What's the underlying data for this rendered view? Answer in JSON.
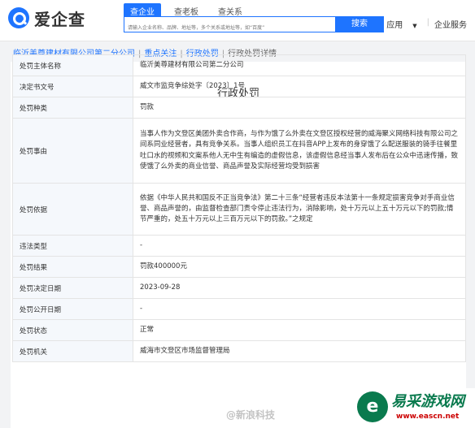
{
  "header": {
    "logo_text": "爱企查",
    "tabs": [
      "查企业",
      "查老板",
      "查关系"
    ],
    "search_placeholder": "请输入企业名称、品牌、地址等，多个关系或地址等，如“百度”",
    "search_button": "搜索",
    "nav": {
      "app": "应用",
      "service": "企业服务"
    }
  },
  "breadcrumb": {
    "company": "临沂美尊建材有限公司第二分公司",
    "follow": "重点关注",
    "penalty": "行政处罚",
    "current": "行政处罚详情"
  },
  "panel": {
    "title": "行政处罚",
    "rows": [
      {
        "label": "处罚主体名称",
        "value": "临沂美尊建材有限公司第二分公司"
      },
      {
        "label": "决定书文号",
        "value": "威文市监竞争综处字〔2023〕1号"
      },
      {
        "label": "处罚种类",
        "value": "罚款"
      },
      {
        "label": "处罚事由",
        "value": "当事人作为文登区美团外卖合作商，与作为饿了么外卖在文登区授权经营的威海聚义网络科技有限公司之间系同业经营者，具有竞争关系。当事人组织员工在抖音APP上发布的身穿饿了么配送服装的骑手往餐里吐口水的视频和文案系他人无中生有编造的虚假信息，该虚假信息经当事人发布后在公众中迅速传播，致使饿了么外卖的商业信誉、商品声誉及实际经营均受到损害"
      },
      {
        "label": "处罚依据",
        "value": "依据《中华人民共和国反不正当竞争法》第二十三条“经营者违反本法第十一条规定损害竞争对手商业信誉、商品声誉的，由监督检查部门责令停止违法行为，消除影响，处十万元以上五十万元以下的罚款;情节严重的，处五十万元以上三百万元以下的罚款。”之规定"
      },
      {
        "label": "违法类型",
        "value": "-"
      },
      {
        "label": "处罚结果",
        "value": "罚款400000元"
      },
      {
        "label": "处罚决定日期",
        "value": "2023-09-28"
      },
      {
        "label": "处罚公开日期",
        "value": "-"
      },
      {
        "label": "处罚状态",
        "value": "正常"
      },
      {
        "label": "处罚机关",
        "value": "威海市文登区市场监督管理局"
      }
    ]
  },
  "watermark": {
    "weibo": "@新浪科技",
    "site_cn": "易采游戏网",
    "site_url": "www.eascn.net"
  }
}
